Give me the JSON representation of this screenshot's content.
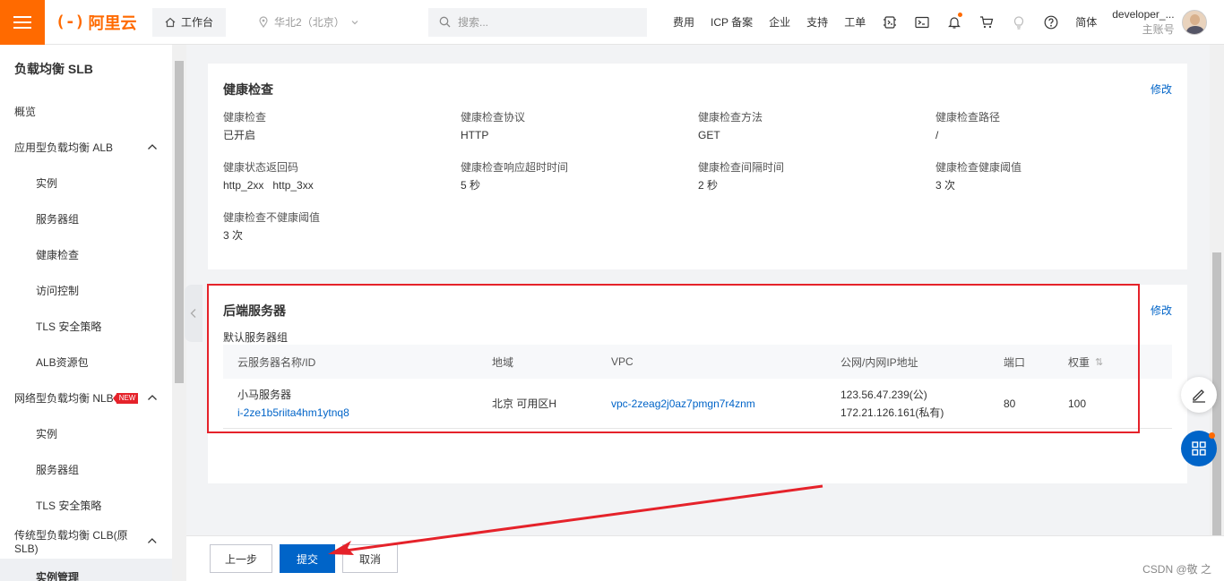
{
  "topbar": {
    "brand_mark": "(-)",
    "brand_name": "阿里云",
    "workbench": "工作台",
    "region": "华北2（北京）",
    "search_placeholder": "搜索...",
    "links": [
      "费用",
      "ICP 备案",
      "企业",
      "支持",
      "工单"
    ],
    "lang": "简体",
    "user_name": "developer_...",
    "user_role": "主账号"
  },
  "sidebar": {
    "title": "负载均衡 SLB",
    "overview": "概览",
    "alb": {
      "label": "应用型负载均衡 ALB",
      "items": [
        "实例",
        "服务器组",
        "健康检查",
        "访问控制",
        "TLS 安全策略",
        "ALB资源包"
      ]
    },
    "nlb": {
      "label": "网络型负载均衡 NLB",
      "badge": "NEW",
      "items": [
        "实例",
        "服务器组",
        "TLS 安全策略"
      ]
    },
    "clb": {
      "label": "传统型负载均衡 CLB(原SLB)",
      "items": [
        "实例管理"
      ]
    }
  },
  "health": {
    "title": "健康检查",
    "edit": "修改",
    "fields": [
      {
        "label": "健康检查",
        "value": "已开启"
      },
      {
        "label": "健康检查协议",
        "value": "HTTP"
      },
      {
        "label": "健康检查方法",
        "value": "GET"
      },
      {
        "label": "健康检查路径",
        "value": "/"
      },
      {
        "label": "健康状态返回码",
        "value": "http_2xx   http_3xx"
      },
      {
        "label": "健康检查响应超时时间",
        "value": "5 秒"
      },
      {
        "label": "健康检查间隔时间",
        "value": "2 秒"
      },
      {
        "label": "健康检查健康阈值",
        "value": "3 次"
      },
      {
        "label": "健康检查不健康阈值",
        "value": "3 次"
      }
    ]
  },
  "backend": {
    "title": "后端服务器",
    "edit": "修改",
    "group": "默认服务器组",
    "columns": [
      "云服务器名称/ID",
      "地域",
      "VPC",
      "公网/内网IP地址",
      "端口",
      "权重"
    ],
    "rows": [
      {
        "name": "小马服务器",
        "id": "i-2ze1b5riita4hm1ytnq8",
        "region": "北京 可用区H",
        "vpc": "vpc-2zeag2j0az7pmgn7r4znm",
        "public_ip": "123.56.47.239(公)",
        "private_ip": "172.21.126.161(私有)",
        "port": "80",
        "weight": "100"
      }
    ]
  },
  "footer": {
    "prev": "上一步",
    "submit": "提交",
    "cancel": "取消",
    "watermark": "CSDN @敬 之"
  }
}
